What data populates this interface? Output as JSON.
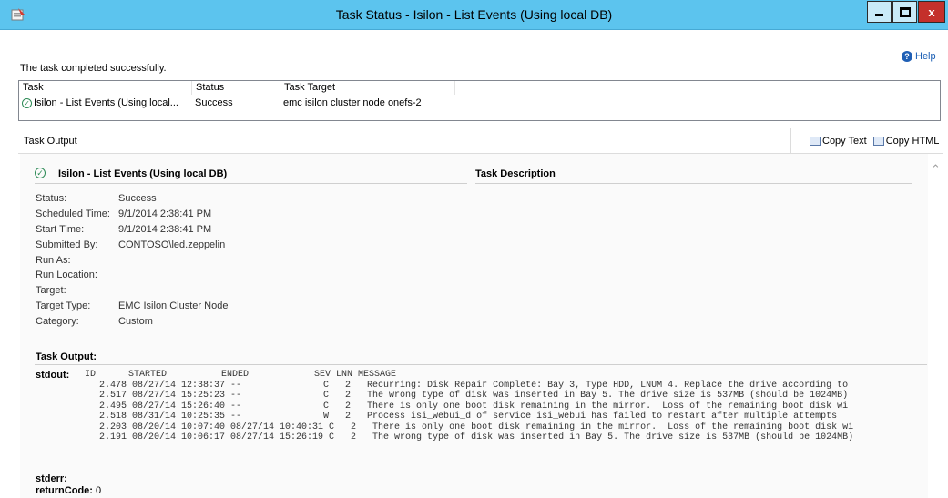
{
  "window": {
    "title": "Task Status - Isilon - List Events (Using local DB)",
    "close_glyph": "x"
  },
  "status_message": "The task completed successfully.",
  "help_label": "Help",
  "task_list": {
    "columns": [
      "Task",
      "Status",
      "Task Target"
    ],
    "rows": [
      {
        "task": "Isilon - List Events (Using local...",
        "status": "Success",
        "target": "emc isilon cluster node onefs-2"
      }
    ]
  },
  "task_output": {
    "header": "Task Output",
    "copy_text": "Copy Text",
    "copy_html": "Copy HTML"
  },
  "report": {
    "title": "Isilon - List Events (Using local DB)",
    "description_heading": "Task Description",
    "details": [
      {
        "label": "Status:",
        "value": "Success"
      },
      {
        "label": "Scheduled Time:",
        "value": "9/1/2014 2:38:41 PM"
      },
      {
        "label": "Start Time:",
        "value": "9/1/2014 2:38:41 PM"
      },
      {
        "label": "Submitted By:",
        "value": "CONTOSO\\led.zeppelin"
      },
      {
        "label": "Run As:",
        "value": ""
      },
      {
        "label": "Run Location:",
        "value": ""
      },
      {
        "label": "Target:",
        "value": ""
      },
      {
        "label": "Target Type:",
        "value": "EMC Isilon Cluster Node"
      },
      {
        "label": "Category:",
        "value": "Custom"
      }
    ],
    "output_heading": "Task Output:",
    "stdout_label": "stdout:",
    "stdout_header": "ID      STARTED          ENDED            SEV LNN MESSAGE",
    "stdout_lines": [
      "2.478 08/27/14 12:38:37 --               C   2   Recurring: Disk Repair Complete: Bay 3, Type HDD, LNUM 4. Replace the drive according to",
      "2.517 08/27/14 15:25:23 --               C   2   The wrong type of disk was inserted in Bay 5. The drive size is 537MB (should be 1024MB)",
      "2.495 08/27/14 15:26:40 --               C   2   There is only one boot disk remaining in the mirror.  Loss of the remaining boot disk wi",
      "2.518 08/31/14 10:25:35 --               W   2   Process isi_webui_d of service isi_webui has failed to restart after multiple attempts",
      "2.203 08/20/14 10:07:40 08/27/14 10:40:31 C   2   There is only one boot disk remaining in the mirror.  Loss of the remaining boot disk wi",
      "2.191 08/20/14 10:06:17 08/27/14 15:26:19 C   2   The wrong type of disk was inserted in Bay 5. The drive size is 537MB (should be 1024MB)"
    ],
    "stderr_label": "stderr:",
    "return_code_label": "returnCode:",
    "return_code_value": "0"
  }
}
